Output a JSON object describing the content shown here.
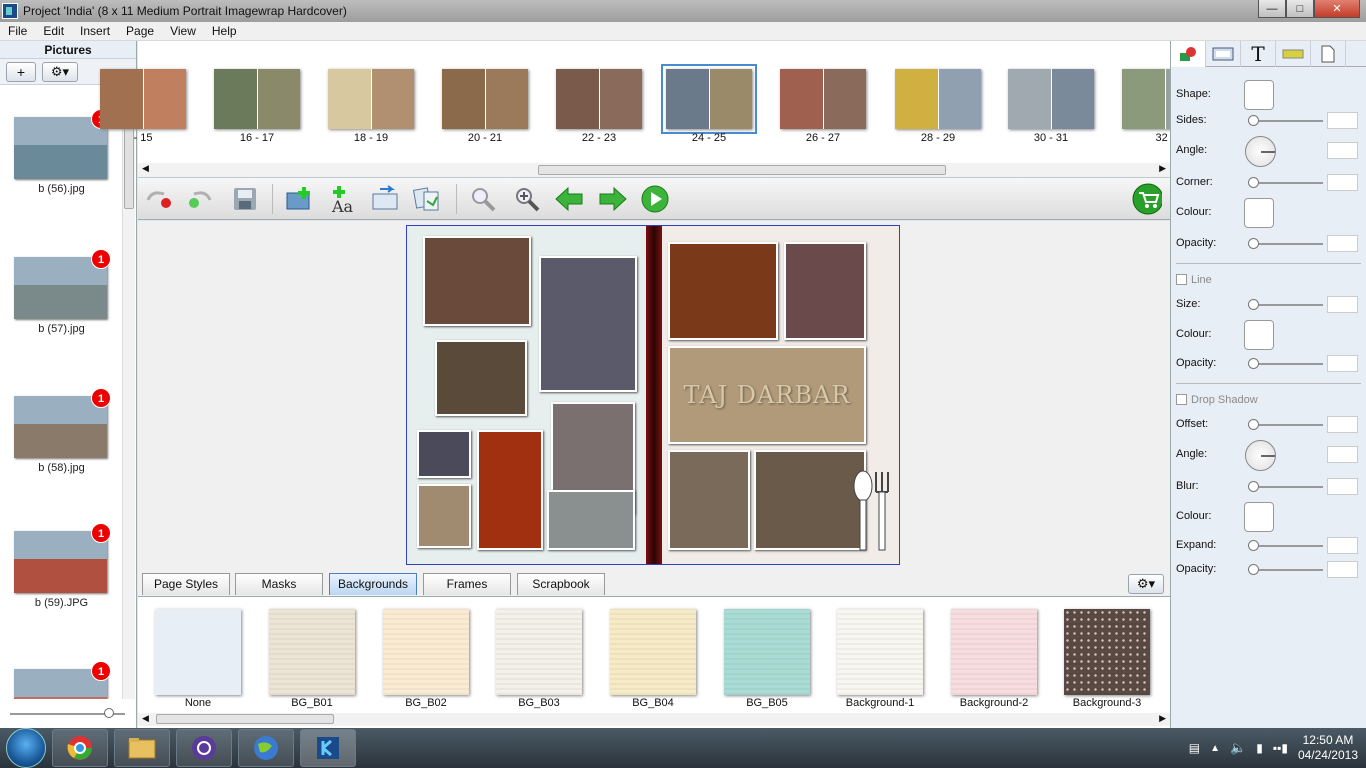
{
  "window": {
    "title": "Project 'India' (8 x 11 Medium Portrait Imagewrap Hardcover)"
  },
  "menu": [
    "File",
    "Edit",
    "Insert",
    "Page",
    "View",
    "Help"
  ],
  "pictures": {
    "header": "Pictures",
    "items": [
      {
        "name": "b (56).jpg",
        "badge": "1",
        "color": "#6a8a9a"
      },
      {
        "name": "b (57).jpg",
        "badge": "1",
        "color": "#7a8a8a"
      },
      {
        "name": "b (58).jpg",
        "badge": "1",
        "color": "#8a7a6a"
      },
      {
        "name": "b (59).JPG",
        "badge": "1",
        "color": "#b05040"
      },
      {
        "name": "",
        "badge": "1",
        "color": "#c07060"
      }
    ]
  },
  "page_strip": [
    {
      "label": "- 15",
      "color1": "#a07050",
      "color2": "#c08060"
    },
    {
      "label": "16 - 17",
      "color1": "#6a7a5a",
      "color2": "#8a8a6a"
    },
    {
      "label": "18 - 19",
      "color1": "#d8c8a0",
      "color2": "#b09070"
    },
    {
      "label": "20 - 21",
      "color1": "#8a6a4a",
      "color2": "#9a7a5a"
    },
    {
      "label": "22 - 23",
      "color1": "#7a5a4a",
      "color2": "#8a6a5a"
    },
    {
      "label": "24 - 25",
      "color1": "#6a7a8a",
      "color2": "#9a8a6a",
      "selected": true
    },
    {
      "label": "26 - 27",
      "color1": "#a06050",
      "color2": "#8a6a5a"
    },
    {
      "label": "28 - 29",
      "color1": "#d0b040",
      "color2": "#90a0b0"
    },
    {
      "label": "30 - 31",
      "color1": "#a0a8b0",
      "color2": "#7a8a9a"
    },
    {
      "label": "32 -",
      "color1": "#8a9a7a",
      "color2": "#9aa0a0"
    }
  ],
  "spread_photos": {
    "left": [
      {
        "c": "#6a4a3a"
      },
      {
        "c": "#5a5a6a"
      },
      {
        "c": "#5a4a3a"
      },
      {
        "c": "#7a7070"
      },
      {
        "c": "#4a4a5a"
      },
      {
        "c": "#a03010"
      },
      {
        "c": "#a08a70"
      },
      {
        "c": "#8a9090"
      }
    ],
    "right": [
      {
        "c": "#7a3a1a"
      },
      {
        "c": "#6a4a4a"
      },
      {
        "c": "#b09a7a"
      },
      {
        "c": "#7a6a5a"
      },
      {
        "c": "#6a5a4a"
      }
    ],
    "sign_text": "TAJ DARBAR"
  },
  "tabs": [
    {
      "label": "Page Styles"
    },
    {
      "label": "Masks"
    },
    {
      "label": "Backgrounds",
      "active": true
    },
    {
      "label": "Frames"
    },
    {
      "label": "Scrapbook"
    }
  ],
  "backgrounds": [
    {
      "name": "None",
      "color": "#e8eef6"
    },
    {
      "name": "BG_B01",
      "color": "#ece4d4"
    },
    {
      "name": "BG_B02",
      "color": "#fbebd3"
    },
    {
      "name": "BG_B03",
      "color": "#f4f0ea"
    },
    {
      "name": "BG_B04",
      "color": "#f6ebc6"
    },
    {
      "name": "BG_B05",
      "color": "#a9dcd4"
    },
    {
      "name": "Background-1",
      "color": "#f8f6f0"
    },
    {
      "name": "Background-2",
      "color": "#f7dde0"
    },
    {
      "name": "Background-3",
      "color": "#5a4a44"
    }
  ],
  "properties": {
    "shape": "Shape:",
    "sides": "Sides:",
    "angle": "Angle:",
    "corner": "Corner:",
    "colour": "Colour:",
    "opacity": "Opacity:",
    "line": "Line",
    "size": "Size:",
    "line_colour": "Colour:",
    "line_opacity": "Opacity:",
    "drop_shadow": "Drop Shadow",
    "offset": "Offset:",
    "ds_angle": "Angle:",
    "blur": "Blur:",
    "ds_colour": "Colour:",
    "expand": "Expand:",
    "ds_opacity": "Opacity:"
  },
  "clock": {
    "time": "12:50 AM",
    "date": "04/24/2013"
  }
}
